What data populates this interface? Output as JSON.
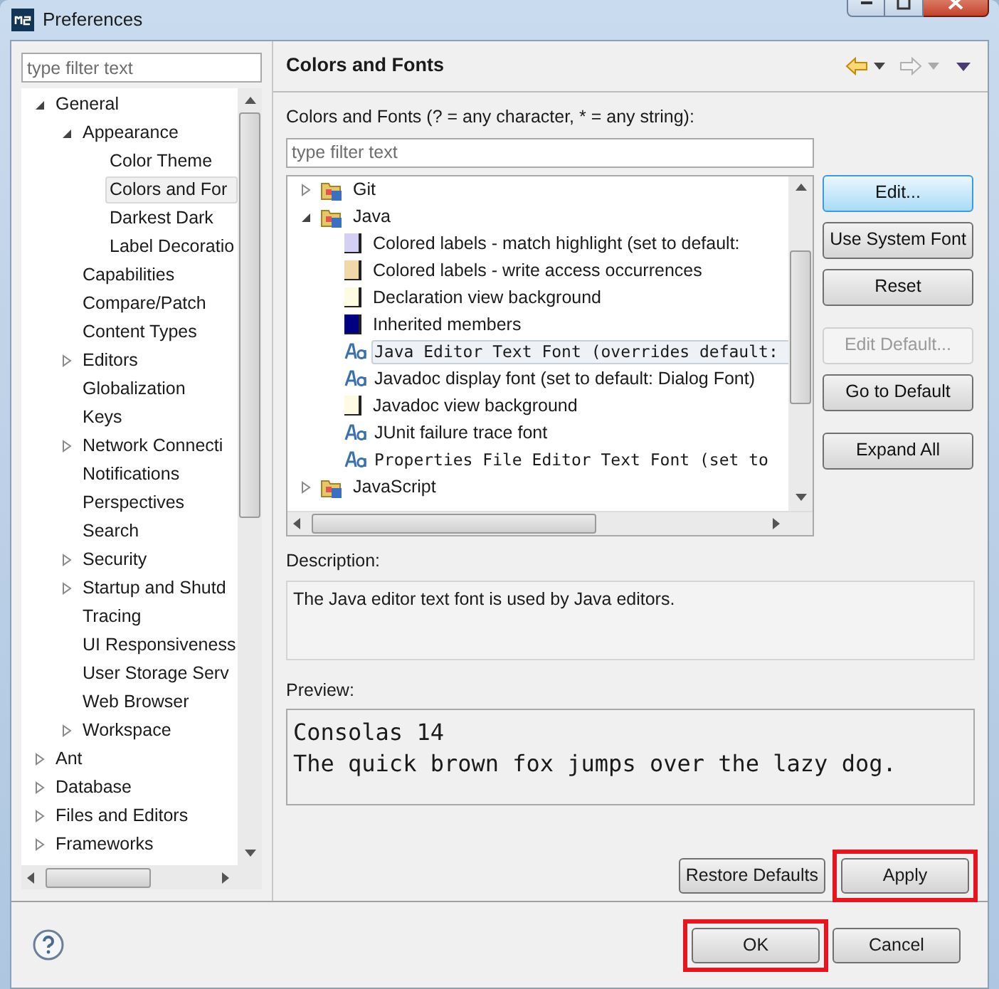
{
  "window": {
    "title": "Preferences"
  },
  "filter": {
    "placeholder": "type filter text"
  },
  "nav_tree": [
    {
      "label": "General",
      "expanded": true,
      "selected": false,
      "children": [
        {
          "label": "Appearance",
          "expanded": true,
          "selected": false,
          "children": [
            {
              "label": "Color Theme",
              "selected": false
            },
            {
              "label": "Colors and For",
              "selected": true
            },
            {
              "label": "Darkest Dark",
              "selected": false
            },
            {
              "label": "Label Decoratio",
              "selected": false
            }
          ]
        },
        {
          "label": "Capabilities",
          "selected": false
        },
        {
          "label": "Compare/Patch",
          "selected": false
        },
        {
          "label": "Content Types",
          "selected": false
        },
        {
          "label": "Editors",
          "expanded": false,
          "selected": false
        },
        {
          "label": "Globalization",
          "selected": false
        },
        {
          "label": "Keys",
          "selected": false
        },
        {
          "label": "Network Connecti",
          "expanded": false,
          "selected": false
        },
        {
          "label": "Notifications",
          "selected": false
        },
        {
          "label": "Perspectives",
          "selected": false
        },
        {
          "label": "Search",
          "selected": false
        },
        {
          "label": "Security",
          "expanded": false,
          "selected": false
        },
        {
          "label": "Startup and Shutd",
          "expanded": false,
          "selected": false
        },
        {
          "label": "Tracing",
          "selected": false
        },
        {
          "label": "UI Responsiveness",
          "selected": false
        },
        {
          "label": "User Storage Serv",
          "selected": false
        },
        {
          "label": "Web Browser",
          "selected": false
        },
        {
          "label": "Workspace",
          "expanded": false,
          "selected": false
        }
      ]
    },
    {
      "label": "Ant",
      "expanded": false,
      "selected": false
    },
    {
      "label": "Database",
      "expanded": false,
      "selected": false
    },
    {
      "label": "Files and Editors",
      "expanded": false,
      "selected": false
    },
    {
      "label": "Frameworks",
      "expanded": false,
      "selected": false
    }
  ],
  "page": {
    "title": "Colors and Fonts",
    "filter_label": "Colors and Fonts (? = any character, * = any string):",
    "filter_placeholder": "type filter text",
    "tree": [
      {
        "kind": "folder",
        "label": "Git",
        "expanded": false,
        "selected": false
      },
      {
        "kind": "folder",
        "label": "Java",
        "expanded": true,
        "selected": false,
        "children": [
          {
            "kind": "color",
            "label": "Colored labels - match highlight (set to default:",
            "color": "#d4d0f4",
            "selected": false
          },
          {
            "kind": "color",
            "label": "Colored labels - write access occurrences",
            "color": "#f0d8a8",
            "selected": false
          },
          {
            "kind": "color",
            "label": "Declaration view background",
            "color": "#fdfbe2",
            "selected": false
          },
          {
            "kind": "color",
            "label": "Inherited members",
            "color": "#000080",
            "selected": false
          },
          {
            "kind": "font",
            "label": "Java Editor Text Font (overrides default:",
            "monospace": true,
            "selected": true
          },
          {
            "kind": "font",
            "label": "Javadoc display font (set to default: Dialog Font)",
            "monospace": false,
            "selected": false
          },
          {
            "kind": "color",
            "label": "Javadoc view background",
            "color": "#fdfbe2",
            "selected": false
          },
          {
            "kind": "font",
            "label": "JUnit failure trace font",
            "monospace": false,
            "selected": false
          },
          {
            "kind": "font",
            "label": "Properties File Editor Text Font (set to",
            "monospace": true,
            "selected": false
          }
        ]
      },
      {
        "kind": "folder",
        "label": "JavaScript",
        "expanded": false,
        "selected": false
      }
    ],
    "side_buttons": [
      {
        "label": "Edit...",
        "disabled": false,
        "default": true
      },
      {
        "label": "Use System Font",
        "disabled": false,
        "default": false
      },
      {
        "label": "Reset",
        "disabled": false,
        "default": false
      },
      {
        "label": "Edit Default...",
        "disabled": true,
        "default": false
      },
      {
        "label": "Go to Default",
        "disabled": false,
        "default": false
      },
      {
        "label": "Expand All",
        "disabled": false,
        "default": false
      }
    ],
    "description_label": "Description:",
    "description": "The Java editor text font is used by Java editors.",
    "preview_label": "Preview:",
    "preview_lines": [
      "Consolas 14",
      "The quick brown fox jumps over the lazy dog."
    ],
    "buttons": [
      {
        "label": "Restore Defaults",
        "highlighted": false
      },
      {
        "label": "Apply",
        "highlighted": true
      }
    ]
  },
  "footer_buttons": [
    {
      "label": "OK",
      "highlighted": true
    },
    {
      "label": "Cancel",
      "highlighted": false
    }
  ]
}
